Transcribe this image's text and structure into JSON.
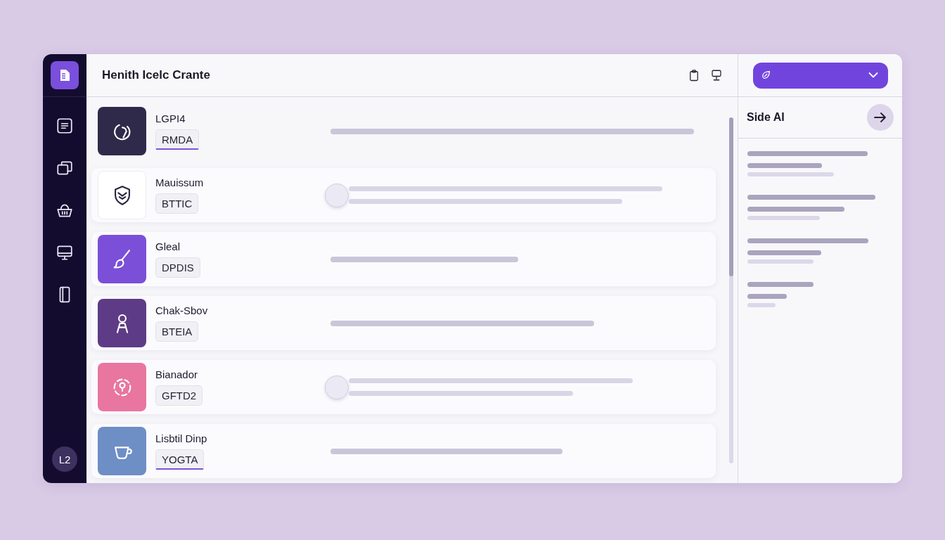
{
  "app": {
    "avatar": "L2"
  },
  "header": {
    "title": "Henith Icelc Crante"
  },
  "rows": [
    {
      "name": "LGPI4",
      "tag": "RMDA",
      "color": "#2f2a4a",
      "selected": true,
      "kind": "line"
    },
    {
      "name": "Mauissum",
      "tag": "BTTIC",
      "color": "#ffffff",
      "selected": false,
      "kind": "slider",
      "level": 0
    },
    {
      "name": "Gleal",
      "tag": "DPDIS",
      "color": "#7b4fd8",
      "selected": false,
      "kind": "line"
    },
    {
      "name": "Chak-Sbov",
      "tag": "BTEIA",
      "color": "#5e3b86",
      "selected": false,
      "kind": "line"
    },
    {
      "name": "Bianador",
      "tag": "GFTD2",
      "color": "#e8769e",
      "selected": false,
      "kind": "slider",
      "level": 0
    },
    {
      "name": "Lisbtil Dinp",
      "tag": "YOGTA",
      "color": "#6e8ec6",
      "selected": true,
      "kind": "line"
    }
  ],
  "side_panel": {
    "title": "Side AI"
  }
}
